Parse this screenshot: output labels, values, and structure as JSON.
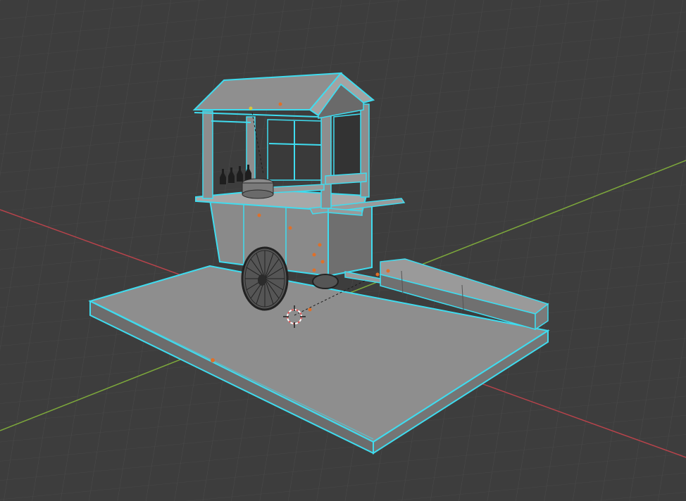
{
  "viewport": {
    "background_color": "#3d3d3d",
    "grid_color": "#4a4a4a",
    "x_axis_color": "#b8434b",
    "y_axis_color": "#7da83b",
    "selection_color": "#3fdcef",
    "mesh_color": "#8c8c8c",
    "origin_color": "#e07028",
    "cursor_color": "#e35a5a"
  },
  "scene": {
    "objects": [
      {
        "name": "base-platform",
        "selected": true
      },
      {
        "name": "food-cart",
        "selected": true
      },
      {
        "name": "bench",
        "selected": true
      }
    ]
  }
}
